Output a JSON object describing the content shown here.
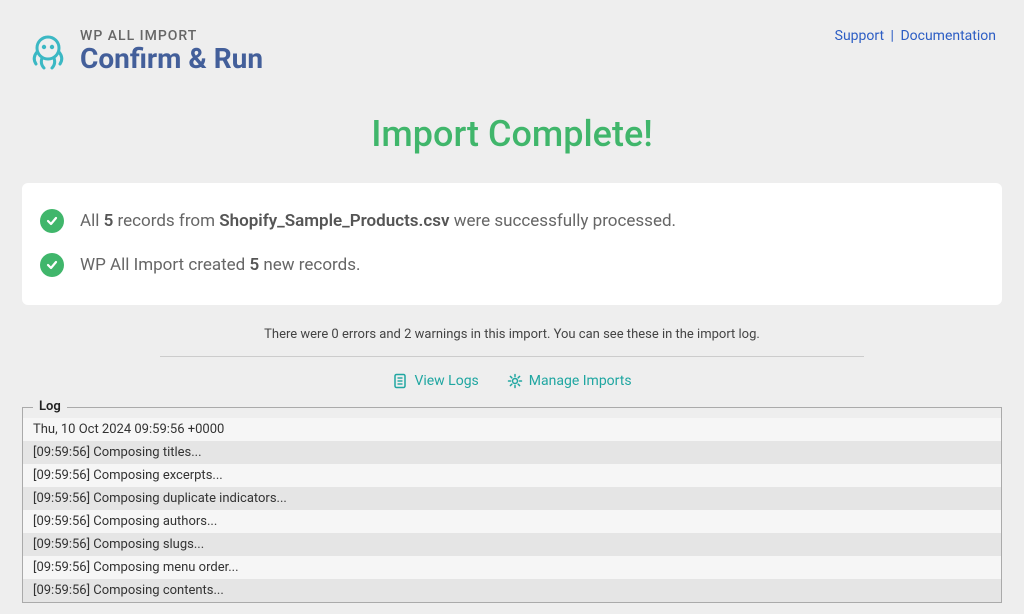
{
  "header": {
    "product_name": "WP ALL IMPORT",
    "page_title": "Confirm & Run",
    "links": {
      "support": "Support",
      "documentation": "Documentation"
    }
  },
  "complete_title": "Import Complete!",
  "summary": {
    "line1_prefix": "All ",
    "line1_count": "5",
    "line1_mid": " records from ",
    "line1_file": "Shopify_Sample_Products.csv",
    "line1_suffix": " were successfully processed.",
    "line2_prefix": "WP All Import created ",
    "line2_count": "5",
    "line2_suffix": " new records."
  },
  "meta_text": "There were 0 errors and 2 warnings in this import. You can see these in the import log.",
  "actions": {
    "view_logs": "View Logs",
    "manage_imports": "Manage Imports"
  },
  "log": {
    "label": "Log",
    "entries": [
      "Thu, 10 Oct 2024 09:59:56 +0000",
      "[09:59:56] Composing titles...",
      "[09:59:56] Composing excerpts...",
      "[09:59:56] Composing duplicate indicators...",
      "[09:59:56] Composing authors...",
      "[09:59:56] Composing slugs...",
      "[09:59:56] Composing menu order...",
      "[09:59:56] Composing contents..."
    ]
  }
}
